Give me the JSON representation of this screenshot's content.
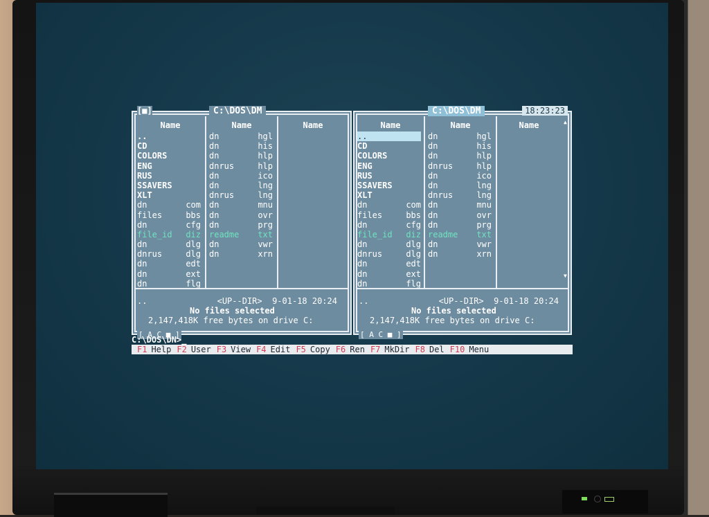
{
  "left_panel": {
    "path": "C:\\DOS\\DM",
    "window_button": "[■]",
    "headers": [
      "Name",
      "Name",
      "Name"
    ],
    "col1": [
      {
        "name": "..",
        "ext": "",
        "kind": "dir"
      },
      {
        "name": "CD",
        "ext": "",
        "kind": "dir"
      },
      {
        "name": "COLORS",
        "ext": "",
        "kind": "dir"
      },
      {
        "name": "ENG",
        "ext": "",
        "kind": "dir"
      },
      {
        "name": "RUS",
        "ext": "",
        "kind": "dir"
      },
      {
        "name": "SSAVERS",
        "ext": "",
        "kind": "dir"
      },
      {
        "name": "XLT",
        "ext": "",
        "kind": "dir"
      },
      {
        "name": "dn",
        "ext": "com",
        "kind": "file"
      },
      {
        "name": "files",
        "ext": "bbs",
        "kind": "file"
      },
      {
        "name": "dn",
        "ext": "cfg",
        "kind": "file"
      },
      {
        "name": "file_id",
        "ext": "diz",
        "kind": "hl"
      },
      {
        "name": "dn",
        "ext": "dlg",
        "kind": "file"
      },
      {
        "name": "dnrus",
        "ext": "dlg",
        "kind": "file"
      },
      {
        "name": "dn",
        "ext": "edt",
        "kind": "file"
      },
      {
        "name": "dn",
        "ext": "ext",
        "kind": "file"
      },
      {
        "name": "dn",
        "ext": "flg",
        "kind": "file"
      }
    ],
    "col2": [
      {
        "name": "dn",
        "ext": "hgl",
        "kind": "file"
      },
      {
        "name": "dn",
        "ext": "his",
        "kind": "file"
      },
      {
        "name": "dn",
        "ext": "hlp",
        "kind": "file"
      },
      {
        "name": "dnrus",
        "ext": "hlp",
        "kind": "file"
      },
      {
        "name": "dn",
        "ext": "ico",
        "kind": "file"
      },
      {
        "name": "dn",
        "ext": "lng",
        "kind": "file"
      },
      {
        "name": "dnrus",
        "ext": "lng",
        "kind": "file"
      },
      {
        "name": "dn",
        "ext": "mnu",
        "kind": "file"
      },
      {
        "name": "dn",
        "ext": "ovr",
        "kind": "file"
      },
      {
        "name": "dn",
        "ext": "prg",
        "kind": "file"
      },
      {
        "name": "readme",
        "ext": "txt",
        "kind": "hl"
      },
      {
        "name": "dn",
        "ext": "vwr",
        "kind": "file"
      },
      {
        "name": "dn",
        "ext": "xrn",
        "kind": "file"
      }
    ],
    "status_line": "..              <UP--DIR>  9-01-18 20:24",
    "selected": "No files selected",
    "free": "2,147,418K free bytes on drive C:",
    "drive_label": "[ A C ■ ]"
  },
  "right_panel": {
    "path": "C:\\DOS\\DM",
    "clock": "18:23:23",
    "headers": [
      "Name",
      "Name",
      "Name"
    ],
    "col1": [
      {
        "name": "..",
        "ext": "",
        "kind": "cur"
      },
      {
        "name": "CD",
        "ext": "",
        "kind": "dir"
      },
      {
        "name": "COLORS",
        "ext": "",
        "kind": "dir"
      },
      {
        "name": "ENG",
        "ext": "",
        "kind": "dir"
      },
      {
        "name": "RUS",
        "ext": "",
        "kind": "dir"
      },
      {
        "name": "SSAVERS",
        "ext": "",
        "kind": "dir"
      },
      {
        "name": "XLT",
        "ext": "",
        "kind": "dir"
      },
      {
        "name": "dn",
        "ext": "com",
        "kind": "file"
      },
      {
        "name": "files",
        "ext": "bbs",
        "kind": "file"
      },
      {
        "name": "dn",
        "ext": "cfg",
        "kind": "file"
      },
      {
        "name": "file_id",
        "ext": "diz",
        "kind": "hl"
      },
      {
        "name": "dn",
        "ext": "dlg",
        "kind": "file"
      },
      {
        "name": "dnrus",
        "ext": "dlg",
        "kind": "file"
      },
      {
        "name": "dn",
        "ext": "edt",
        "kind": "file"
      },
      {
        "name": "dn",
        "ext": "ext",
        "kind": "file"
      },
      {
        "name": "dn",
        "ext": "flg",
        "kind": "file"
      }
    ],
    "col2": [
      {
        "name": "dn",
        "ext": "hgl",
        "kind": "file"
      },
      {
        "name": "dn",
        "ext": "his",
        "kind": "file"
      },
      {
        "name": "dn",
        "ext": "hlp",
        "kind": "file"
      },
      {
        "name": "dnrus",
        "ext": "hlp",
        "kind": "file"
      },
      {
        "name": "dn",
        "ext": "ico",
        "kind": "file"
      },
      {
        "name": "dn",
        "ext": "lng",
        "kind": "file"
      },
      {
        "name": "dnrus",
        "ext": "lng",
        "kind": "file"
      },
      {
        "name": "dn",
        "ext": "mnu",
        "kind": "file"
      },
      {
        "name": "dn",
        "ext": "ovr",
        "kind": "file"
      },
      {
        "name": "dn",
        "ext": "prg",
        "kind": "file"
      },
      {
        "name": "readme",
        "ext": "txt",
        "kind": "hl"
      },
      {
        "name": "dn",
        "ext": "vwr",
        "kind": "file"
      },
      {
        "name": "dn",
        "ext": "xrn",
        "kind": "file"
      }
    ],
    "status_line": "..              <UP--DIR>  9-01-18 20:24",
    "selected": "No files selected",
    "free": "2,147,418K free bytes on drive C:",
    "drive_label": "[ A C ■ ]",
    "scroll_up": "▲",
    "scroll_down": "▼"
  },
  "command_line": "C:\\DOS\\DN>_",
  "function_keys": [
    {
      "num": "F1",
      "label": "Help"
    },
    {
      "num": "F2",
      "label": "User"
    },
    {
      "num": "F3",
      "label": "View"
    },
    {
      "num": "F4",
      "label": "Edit"
    },
    {
      "num": "F5",
      "label": "Copy"
    },
    {
      "num": "F6",
      "label": "Ren"
    },
    {
      "num": "F7",
      "label": "MkDir"
    },
    {
      "num": "F8",
      "label": "Del"
    },
    {
      "num": "F10",
      "label": "Menu"
    }
  ],
  "colors": {
    "panel": "#6e8ca0",
    "accent_key": "#d23b52",
    "highlight": "#6fe3c0"
  }
}
